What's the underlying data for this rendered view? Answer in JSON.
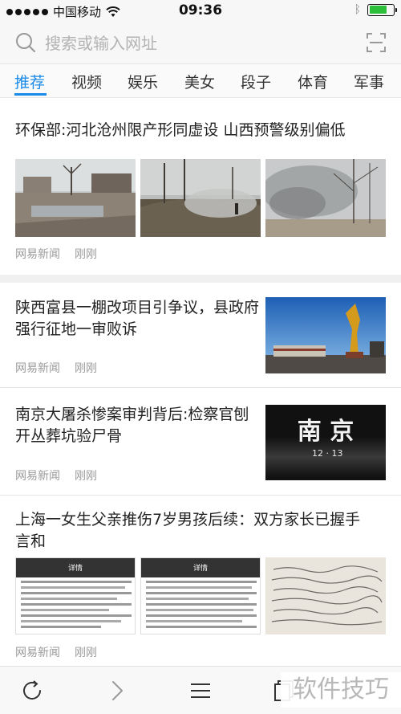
{
  "status_bar": {
    "carrier": "中国移动",
    "time": "09:36",
    "battery_level": 0.75,
    "battery_color": "#2bbf3a"
  },
  "search": {
    "placeholder": "搜索或输入网址",
    "left_icon": "search-icon",
    "right_icon": "scan-icon"
  },
  "tabs": [
    {
      "label": "推荐",
      "active": true
    },
    {
      "label": "视频",
      "active": false
    },
    {
      "label": "娱乐",
      "active": false
    },
    {
      "label": "美女",
      "active": false
    },
    {
      "label": "段子",
      "active": false
    },
    {
      "label": "体育",
      "active": false
    },
    {
      "label": "军事",
      "active": false
    }
  ],
  "accent_color": "#1a8ae8",
  "articles": [
    {
      "title": "环保部:河北沧州限产形同虚设 山西预警级别偏低",
      "source": "网易新闻",
      "time": "刚刚",
      "images": [
        "smog-village-photo",
        "burning-field-photo",
        "haze-trees-photo"
      ]
    },
    {
      "title_lines": [
        "陕西富县一棚改项目引争议，县政府",
        "强行征地一审败诉"
      ],
      "source": "网易新闻",
      "time": "刚刚",
      "image": "golden-statue-photo"
    },
    {
      "title_lines": [
        "南京大屠杀惨案审判背后:检察官刨",
        "开丛葬坑验尸骨"
      ],
      "source": "网易新闻",
      "time": "刚刚",
      "image_text": "南  京",
      "image_subtext": "12 · 13"
    },
    {
      "title_lines": [
        "上海一女生父亲推伤7岁男孩后续：双方家长已握手",
        "言和"
      ],
      "source": "网易新闻",
      "time": "刚刚",
      "images": [
        "chat-screenshot-1",
        "chat-screenshot-2",
        "handwritten-note-photo"
      ],
      "screenshot_header": "详情"
    }
  ],
  "toolbar": {
    "buttons": [
      "refresh-icon",
      "forward-icon",
      "menu-icon",
      "tabs-icon"
    ]
  },
  "watermark": "软件技巧"
}
